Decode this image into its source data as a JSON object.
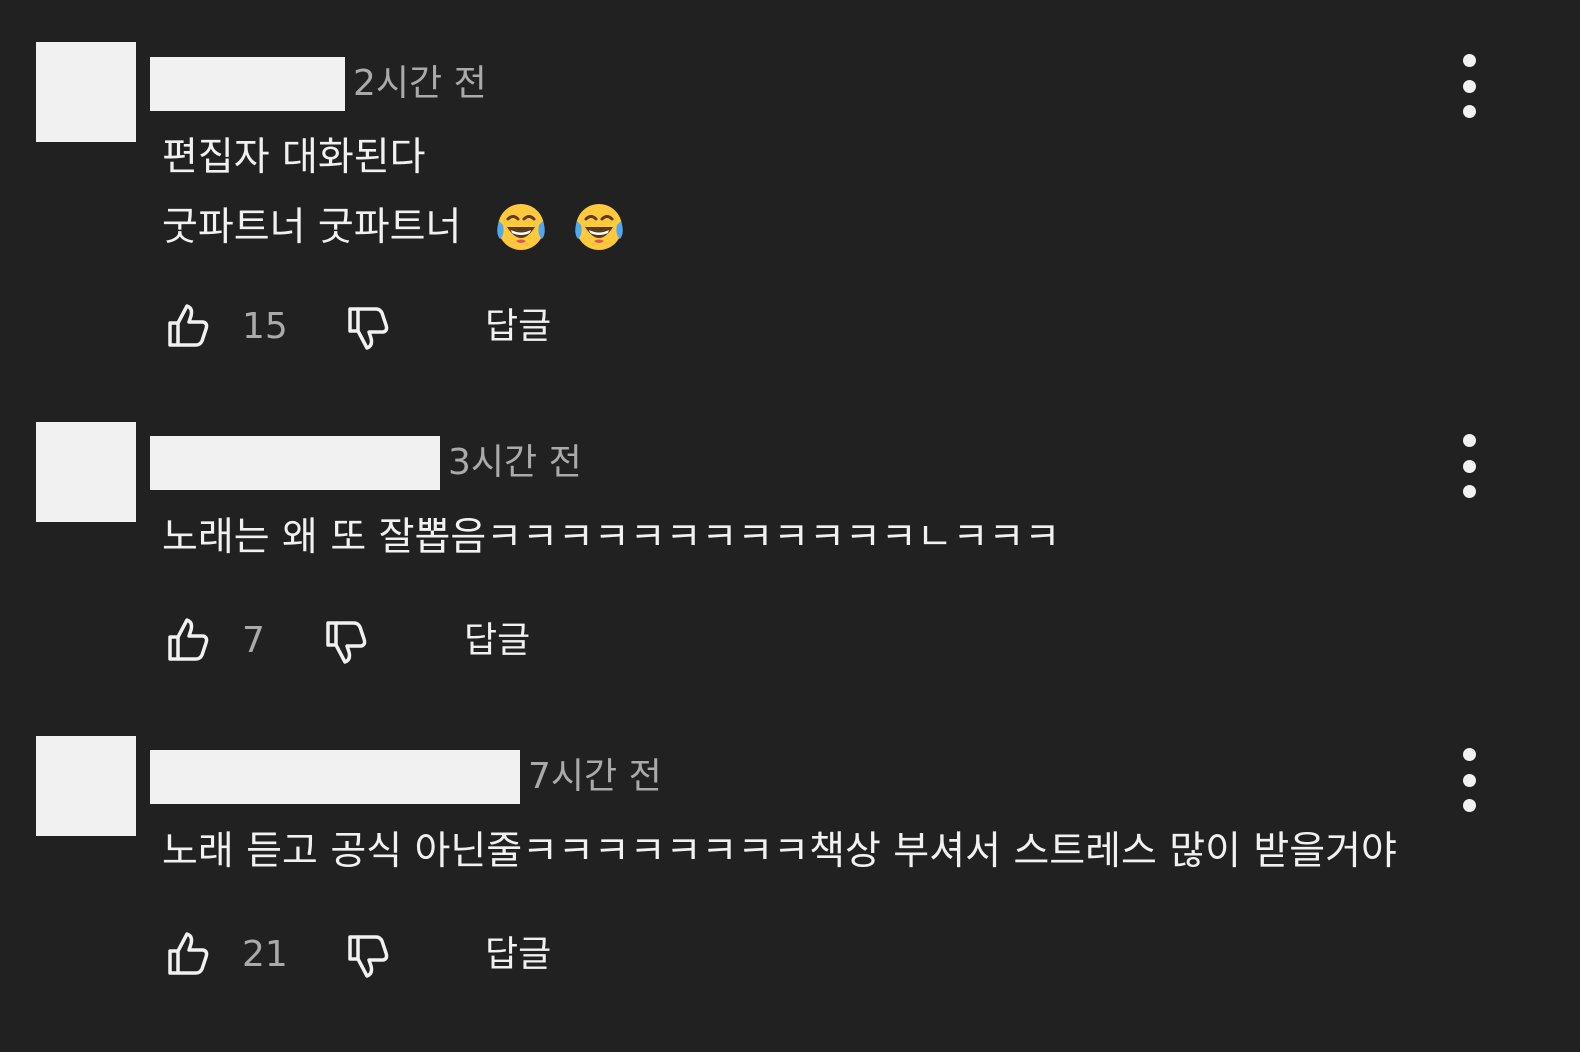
{
  "comments": [
    {
      "time": "2시간 전",
      "lines": [
        "편집자 대화된다",
        "굿파트너 굿파트너"
      ],
      "emoji": [
        "face-with-tears-of-joy",
        "face-with-tears-of-joy"
      ],
      "likes": "15",
      "reply": "답글"
    },
    {
      "time": "3시간 전",
      "lines": [
        "노래는 왜 또 잘뽑음ㅋㅋㅋㅋㅋㅋㅋㅋㅋㅋㅋㅋㄴㅋㅋㅋ"
      ],
      "likes": "7",
      "reply": "답글"
    },
    {
      "time": "7시간 전",
      "lines": [
        "노래 듣고 공식 아닌줄ㅋㅋㅋㅋㅋㅋㅋㅋ책상 부셔서 스트레스 많이 받을거야"
      ],
      "likes": "21",
      "reply": "답글"
    }
  ],
  "colors": {
    "background": "#212121",
    "text": "#f1f1f1",
    "secondary": "#aaaaaa",
    "redaction": "#f1f1f1"
  }
}
